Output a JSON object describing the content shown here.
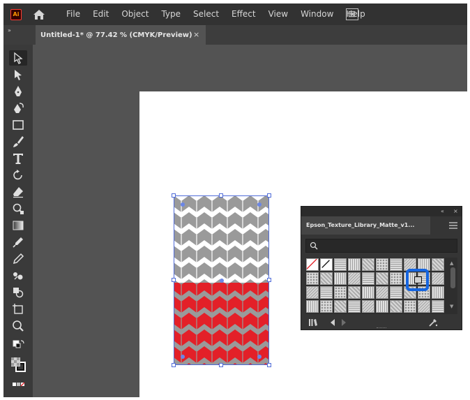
{
  "app": {
    "logo_text": "Ai",
    "menu": [
      "File",
      "Edit",
      "Object",
      "Type",
      "Select",
      "Effect",
      "View",
      "Window",
      "Help"
    ]
  },
  "document": {
    "tab_title": "Untitled-1* @ 77.42 % (CMYK/Preview)",
    "close_glyph": "×"
  },
  "toolbar": {
    "collapse_glyph": "»",
    "tools": [
      "selection-tool",
      "direct-selection-tool",
      "pen-tool",
      "curvature-tool",
      "rectangle-tool",
      "paintbrush-tool",
      "type-tool",
      "rotate-tool",
      "eraser-tool",
      "zoom-select-tool",
      "gradient-tool",
      "eyedropper-tool",
      "pencil-tool",
      "blend-tool",
      "shape-builder-tool",
      "artboard-tool",
      "zoom-tool"
    ]
  },
  "panel": {
    "tab_label": "Epson_Texture_Library_Matte_v1...",
    "collapse_glyph": "«",
    "close_glyph": "×",
    "scroll_up": "▲",
    "scroll_down": "▼"
  },
  "colors": {
    "chrome_dark": "#323232",
    "canvas": "#535353",
    "pattern_red": "#e32028",
    "pattern_gray": "#9a9a9a",
    "selection_blue": "#4f6bd8",
    "highlight_blue": "#1565e0"
  }
}
